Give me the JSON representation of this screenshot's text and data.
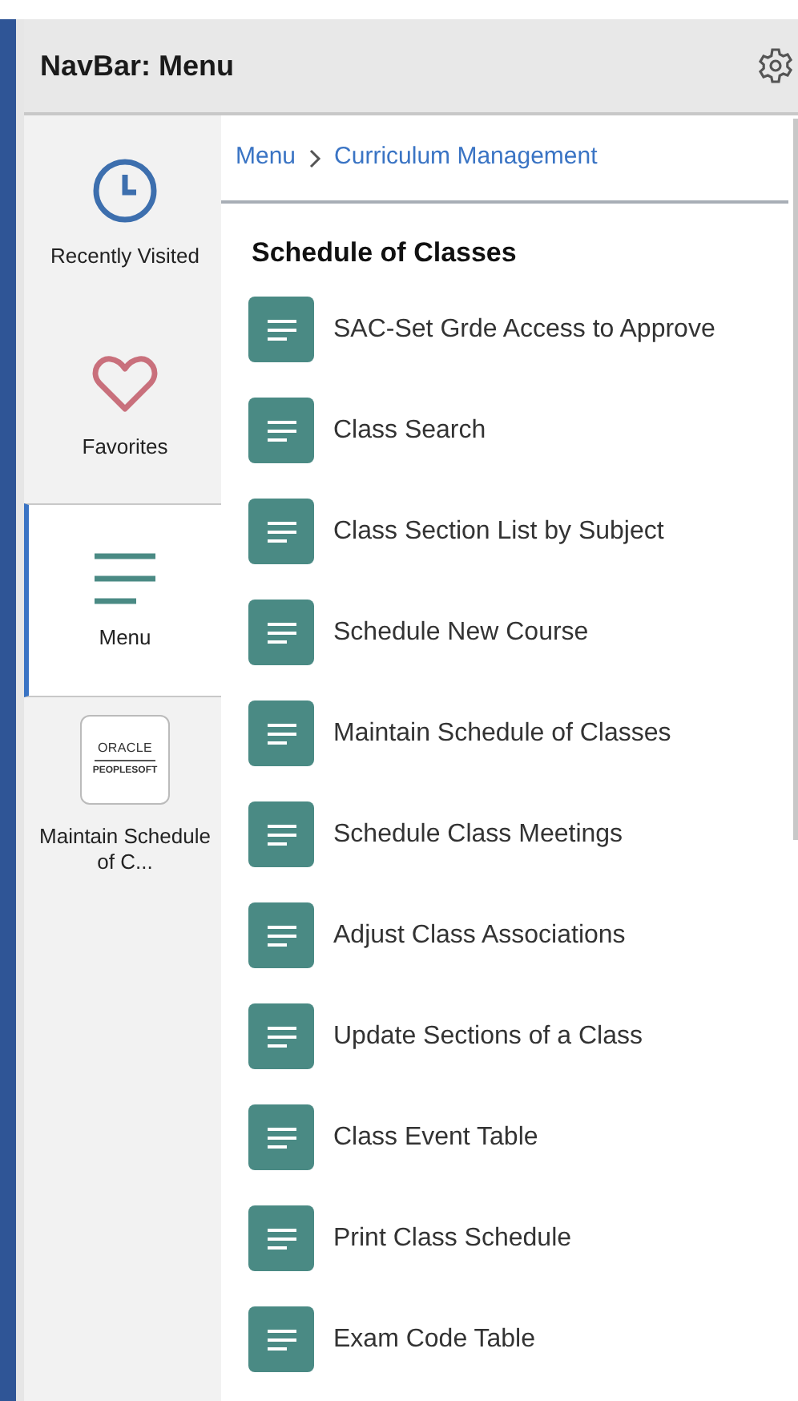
{
  "header": {
    "title": "NavBar: Menu"
  },
  "sidebar": {
    "items": [
      {
        "kind": "clock",
        "label": "Recently Visited",
        "selected": false
      },
      {
        "kind": "heart",
        "label": "Favorites",
        "selected": false
      },
      {
        "kind": "menu",
        "label": "Menu",
        "selected": true
      },
      {
        "kind": "logo",
        "label": "Maintain Schedule of C...",
        "selected": false,
        "logo_top": "ORACLE",
        "logo_bottom": "PEOPLESOFT"
      }
    ]
  },
  "breadcrumb": [
    "Menu",
    "Curriculum Management"
  ],
  "section_title": "Schedule of Classes",
  "items": [
    "SAC-Set Grde Access to Approve",
    "Class Search",
    "Class Section List by Subject",
    "Schedule New Course",
    "Maintain Schedule of Classes",
    "Schedule Class Meetings",
    "Adjust Class Associations",
    "Update Sections of a Class",
    "Class Event Table",
    "Print Class Schedule",
    "Exam Code Table"
  ]
}
